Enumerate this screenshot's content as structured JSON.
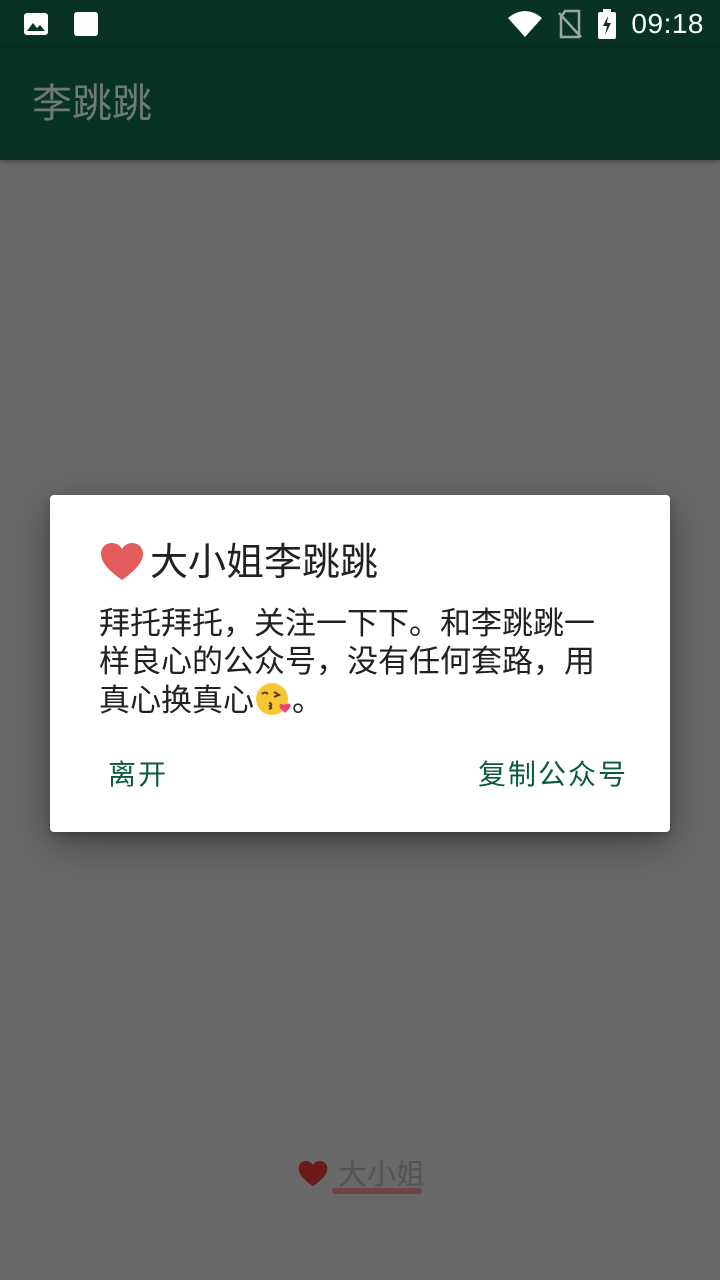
{
  "status_bar": {
    "time": "09:18",
    "icons": [
      "image-notification-icon",
      "square-notification-icon",
      "wifi-icon",
      "no-sim-icon",
      "battery-charging-icon"
    ]
  },
  "app_bar": {
    "title": "李跳跳"
  },
  "dialog": {
    "title_icon": "red-heart-icon",
    "title": "大小姐李跳跳",
    "message_line1": "拜托拜托，关注一下下。和李跳跳一",
    "message_line2": "样良心的公众号，没有任何套路，用",
    "message_line3_text": "真心换真心",
    "message_emoji": "face-throwing-kiss-icon",
    "message_line3_end": "。",
    "leave_label": "离开",
    "copy_label": "复制公众号"
  },
  "bottom_tab": {
    "icon": "dark-red-heart-icon",
    "label": "大小姐"
  },
  "colors": {
    "app_bar": "#083223",
    "scrim": "#696969",
    "dialog_bg": "#ffffff",
    "button_text": "#0b5a3c",
    "heart": "#e35b5b"
  }
}
